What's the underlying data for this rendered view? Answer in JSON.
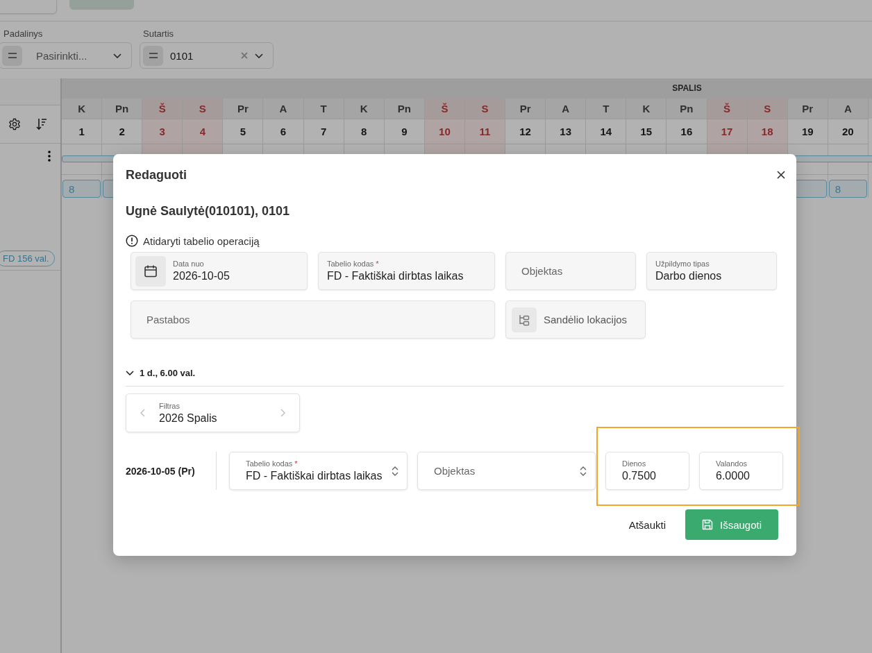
{
  "filters": [
    {
      "label": "Padalinys",
      "placeholder": "Pasirinkti...",
      "clearable": false
    },
    {
      "label": "Sutartis",
      "value": "0101",
      "clearable": true
    }
  ],
  "calendar": {
    "month": "SPALIS",
    "total_badge": "FD 156 val.",
    "days": [
      {
        "weekday": "K",
        "date": "1",
        "weekend": false,
        "marked": true,
        "chip": "8"
      },
      {
        "weekday": "Pn",
        "date": "2",
        "weekend": false,
        "marked": true
      },
      {
        "weekday": "Š",
        "date": "3",
        "weekend": true
      },
      {
        "weekday": "S",
        "date": "4",
        "weekend": true
      },
      {
        "weekday": "Pr",
        "date": "5",
        "weekend": false
      },
      {
        "weekday": "A",
        "date": "6",
        "weekend": false
      },
      {
        "weekday": "T",
        "date": "7",
        "weekend": false
      },
      {
        "weekday": "K",
        "date": "8",
        "weekend": false
      },
      {
        "weekday": "Pn",
        "date": "9",
        "weekend": false
      },
      {
        "weekday": "Š",
        "date": "10",
        "weekend": true
      },
      {
        "weekday": "S",
        "date": "11",
        "weekend": true
      },
      {
        "weekday": "Pr",
        "date": "12",
        "weekend": false
      },
      {
        "weekday": "A",
        "date": "13",
        "weekend": false
      },
      {
        "weekday": "T",
        "date": "14",
        "weekend": false
      },
      {
        "weekday": "K",
        "date": "15",
        "weekend": false
      },
      {
        "weekday": "Pn",
        "date": "16",
        "weekend": false
      },
      {
        "weekday": "Š",
        "date": "17",
        "weekend": true
      },
      {
        "weekday": "S",
        "date": "18",
        "weekend": true
      },
      {
        "weekday": "Pr",
        "date": "19",
        "weekend": false,
        "marked": true
      },
      {
        "weekday": "A",
        "date": "20",
        "weekend": false,
        "marked": true,
        "chip": "8"
      }
    ]
  },
  "modal": {
    "title": "Redaguoti",
    "subtitle": "Ugnė Saulytė(010101), 0101",
    "notice": "Atidaryti tabelio operaciją",
    "fields": [
      {
        "kind": "date",
        "label": "Data nuo",
        "value": "2026-10-05"
      },
      {
        "kind": "select",
        "label": "Tabelio kodas",
        "required_mark": "*",
        "value": "FD - Faktiškai dirbtas laikas"
      },
      {
        "kind": "text",
        "placeholder": "Objektas"
      },
      {
        "kind": "select",
        "label": "Užpildymo tipas",
        "value": "Darbo dienos"
      },
      {
        "kind": "notes",
        "placeholder": "Pastabos"
      },
      {
        "kind": "location",
        "label": "Sandėlio lokacijos"
      }
    ],
    "section": {
      "label": "1 d., 6.00 val.",
      "expanded": true
    },
    "filter": {
      "label": "Filtras",
      "value": "2026 Spalis"
    },
    "entries": [
      {
        "date": "2026-10-05 (Pr)",
        "code": {
          "label": "Tabelio kodas",
          "required_mark": "*",
          "value": "FD - Faktiškai dirbtas laikas"
        },
        "object": {
          "placeholder": "Objektas"
        },
        "days": {
          "label": "Dienos",
          "value": "0.7500"
        },
        "hours": {
          "label": "Valandos",
          "value": "6.0000"
        },
        "highlighted": true
      }
    ],
    "actions": {
      "cancel": "Atšaukti",
      "save": "Išsaugoti"
    }
  }
}
